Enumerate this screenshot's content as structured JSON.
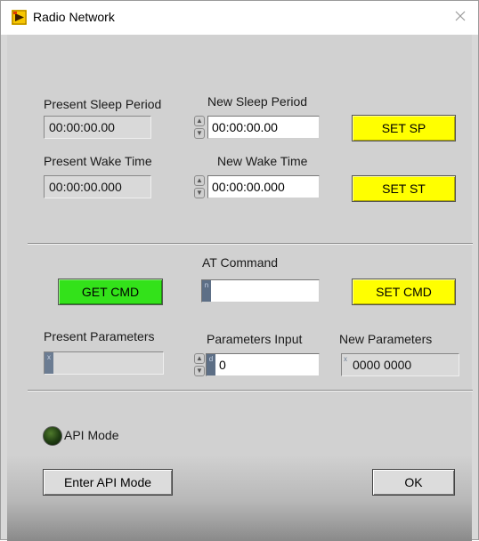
{
  "window": {
    "title": "Radio Network"
  },
  "sleep": {
    "present_label": "Present Sleep Period",
    "present_value": "00:00:00.00",
    "new_label": "New Sleep Period",
    "new_value": "00:00:00.00",
    "set_button": "SET SP"
  },
  "wake": {
    "present_label": "Present Wake Time",
    "present_value": "00:00:00.000",
    "new_label": "New Wake Time",
    "new_value": "00:00:00.000",
    "set_button": "SET ST"
  },
  "at": {
    "label": "AT Command",
    "value": "",
    "radix": "n",
    "get_button": "GET CMD",
    "set_button": "SET CMD"
  },
  "params": {
    "present_label": "Present Parameters",
    "present_value": "",
    "present_radix": "x",
    "input_label": "Parameters Input",
    "input_value": "0",
    "input_radix": "d",
    "new_label": "New Parameters",
    "new_value": "0000 0000",
    "new_radix": "x"
  },
  "api": {
    "led_label": "API Mode",
    "enter_button": "Enter API Mode"
  },
  "ok_button": "OK",
  "colors": {
    "yellow_button": "#ffff00",
    "green_button": "#33e21a",
    "panel": "#d1d1d1",
    "led_off": "#1f3d12"
  }
}
